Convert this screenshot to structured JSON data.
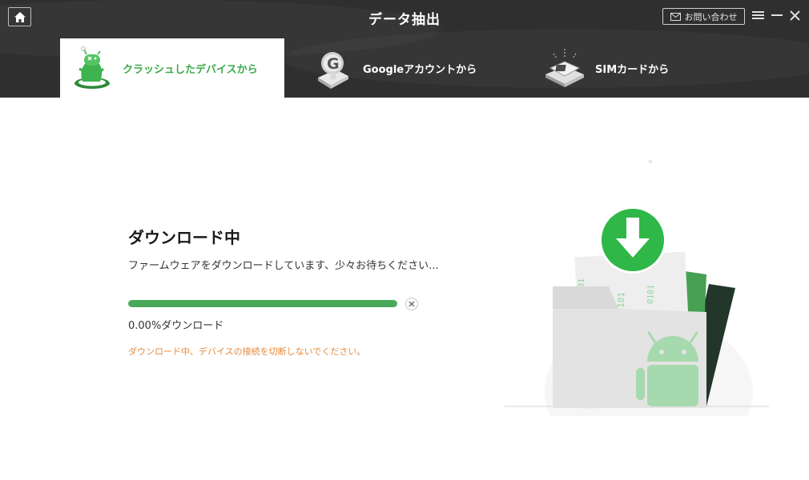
{
  "window": {
    "title": "データ抽出",
    "contact_label": "お問い合わせ"
  },
  "tabs": [
    {
      "label": "クラッシュしたデバイスから",
      "active": true
    },
    {
      "label": "Googleアカウントから",
      "active": false
    },
    {
      "label": "SIMカードから",
      "active": false
    }
  ],
  "main": {
    "title": "ダウンロード中",
    "subtitle": "ファームウェアをダウンロードしています、少々お待ちください...",
    "progress_percent": 0,
    "progress_label": "0.00%ダウンロード",
    "warning": "ダウンロード中、デバイスの接続を切断しないでください。"
  },
  "illustration": {
    "binary_text_1": "0101",
    "binary_text_2": "010101",
    "binary_text_3": "0101"
  },
  "colors": {
    "accent_green": "#3ca94a",
    "progress_green": "#49a85a",
    "warning_orange": "#e8893a",
    "header_bg": "#2f2f2f"
  },
  "icons": {
    "home": "home-icon",
    "mail": "mail-icon",
    "menu": "menu-icon",
    "minimize": "minimize-icon",
    "close": "close-icon",
    "cancel": "cancel-icon",
    "download": "download-arrow-icon",
    "android": "android-icon"
  }
}
